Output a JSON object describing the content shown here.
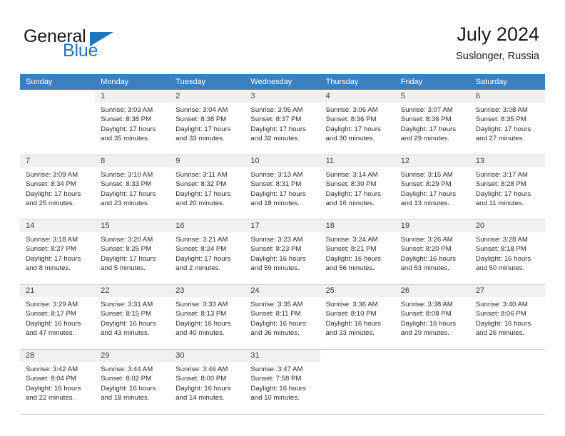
{
  "brand": {
    "name_top": "General",
    "name_bottom": "Blue",
    "color_blue": "#2175bb",
    "triangle_icon": "triangle-icon"
  },
  "header": {
    "title": "July 2024",
    "subtitle": "Suslonger, Russia"
  },
  "theme": {
    "header_row_bg": "#3b7fbf",
    "daynum_bg": "#f0f0f0",
    "grid_line": "#cfcfcf"
  },
  "weekdays": [
    "Sunday",
    "Monday",
    "Tuesday",
    "Wednesday",
    "Thursday",
    "Friday",
    "Saturday"
  ],
  "weeks": [
    [
      {
        "day": "",
        "lines": [
          "",
          "",
          "",
          ""
        ],
        "blank": true
      },
      {
        "day": "1",
        "lines": [
          "Sunrise: 3:03 AM",
          "Sunset: 8:38 PM",
          "Daylight: 17 hours",
          "and 35 minutes."
        ]
      },
      {
        "day": "2",
        "lines": [
          "Sunrise: 3:04 AM",
          "Sunset: 8:38 PM",
          "Daylight: 17 hours",
          "and 33 minutes."
        ]
      },
      {
        "day": "3",
        "lines": [
          "Sunrise: 3:05 AM",
          "Sunset: 8:37 PM",
          "Daylight: 17 hours",
          "and 32 minutes."
        ]
      },
      {
        "day": "4",
        "lines": [
          "Sunrise: 3:06 AM",
          "Sunset: 8:36 PM",
          "Daylight: 17 hours",
          "and 30 minutes."
        ]
      },
      {
        "day": "5",
        "lines": [
          "Sunrise: 3:07 AM",
          "Sunset: 8:36 PM",
          "Daylight: 17 hours",
          "and 29 minutes."
        ]
      },
      {
        "day": "6",
        "lines": [
          "Sunrise: 3:08 AM",
          "Sunset: 8:35 PM",
          "Daylight: 17 hours",
          "and 27 minutes."
        ]
      }
    ],
    [
      {
        "day": "7",
        "lines": [
          "Sunrise: 3:09 AM",
          "Sunset: 8:34 PM",
          "Daylight: 17 hours",
          "and 25 minutes."
        ]
      },
      {
        "day": "8",
        "lines": [
          "Sunrise: 3:10 AM",
          "Sunset: 8:33 PM",
          "Daylight: 17 hours",
          "and 23 minutes."
        ]
      },
      {
        "day": "9",
        "lines": [
          "Sunrise: 3:11 AM",
          "Sunset: 8:32 PM",
          "Daylight: 17 hours",
          "and 20 minutes."
        ]
      },
      {
        "day": "10",
        "lines": [
          "Sunrise: 3:13 AM",
          "Sunset: 8:31 PM",
          "Daylight: 17 hours",
          "and 18 minutes."
        ]
      },
      {
        "day": "11",
        "lines": [
          "Sunrise: 3:14 AM",
          "Sunset: 8:30 PM",
          "Daylight: 17 hours",
          "and 16 minutes."
        ]
      },
      {
        "day": "12",
        "lines": [
          "Sunrise: 3:15 AM",
          "Sunset: 8:29 PM",
          "Daylight: 17 hours",
          "and 13 minutes."
        ]
      },
      {
        "day": "13",
        "lines": [
          "Sunrise: 3:17 AM",
          "Sunset: 8:28 PM",
          "Daylight: 17 hours",
          "and 11 minutes."
        ]
      }
    ],
    [
      {
        "day": "14",
        "lines": [
          "Sunrise: 3:18 AM",
          "Sunset: 8:27 PM",
          "Daylight: 17 hours",
          "and 8 minutes."
        ]
      },
      {
        "day": "15",
        "lines": [
          "Sunrise: 3:20 AM",
          "Sunset: 8:25 PM",
          "Daylight: 17 hours",
          "and 5 minutes."
        ]
      },
      {
        "day": "16",
        "lines": [
          "Sunrise: 3:21 AM",
          "Sunset: 8:24 PM",
          "Daylight: 17 hours",
          "and 2 minutes."
        ]
      },
      {
        "day": "17",
        "lines": [
          "Sunrise: 3:23 AM",
          "Sunset: 8:23 PM",
          "Daylight: 16 hours",
          "and 59 minutes."
        ]
      },
      {
        "day": "18",
        "lines": [
          "Sunrise: 3:24 AM",
          "Sunset: 8:21 PM",
          "Daylight: 16 hours",
          "and 56 minutes."
        ]
      },
      {
        "day": "19",
        "lines": [
          "Sunrise: 3:26 AM",
          "Sunset: 8:20 PM",
          "Daylight: 16 hours",
          "and 53 minutes."
        ]
      },
      {
        "day": "20",
        "lines": [
          "Sunrise: 3:28 AM",
          "Sunset: 8:18 PM",
          "Daylight: 16 hours",
          "and 50 minutes."
        ]
      }
    ],
    [
      {
        "day": "21",
        "lines": [
          "Sunrise: 3:29 AM",
          "Sunset: 8:17 PM",
          "Daylight: 16 hours",
          "and 47 minutes."
        ]
      },
      {
        "day": "22",
        "lines": [
          "Sunrise: 3:31 AM",
          "Sunset: 8:15 PM",
          "Daylight: 16 hours",
          "and 43 minutes."
        ]
      },
      {
        "day": "23",
        "lines": [
          "Sunrise: 3:33 AM",
          "Sunset: 8:13 PM",
          "Daylight: 16 hours",
          "and 40 minutes."
        ]
      },
      {
        "day": "24",
        "lines": [
          "Sunrise: 3:35 AM",
          "Sunset: 8:11 PM",
          "Daylight: 16 hours",
          "and 36 minutes."
        ]
      },
      {
        "day": "25",
        "lines": [
          "Sunrise: 3:36 AM",
          "Sunset: 8:10 PM",
          "Daylight: 16 hours",
          "and 33 minutes."
        ]
      },
      {
        "day": "26",
        "lines": [
          "Sunrise: 3:38 AM",
          "Sunset: 8:08 PM",
          "Daylight: 16 hours",
          "and 29 minutes."
        ]
      },
      {
        "day": "27",
        "lines": [
          "Sunrise: 3:40 AM",
          "Sunset: 8:06 PM",
          "Daylight: 16 hours",
          "and 26 minutes."
        ]
      }
    ],
    [
      {
        "day": "28",
        "lines": [
          "Sunrise: 3:42 AM",
          "Sunset: 8:04 PM",
          "Daylight: 16 hours",
          "and 22 minutes."
        ]
      },
      {
        "day": "29",
        "lines": [
          "Sunrise: 3:44 AM",
          "Sunset: 8:02 PM",
          "Daylight: 16 hours",
          "and 18 minutes."
        ]
      },
      {
        "day": "30",
        "lines": [
          "Sunrise: 3:46 AM",
          "Sunset: 8:00 PM",
          "Daylight: 16 hours",
          "and 14 minutes."
        ]
      },
      {
        "day": "31",
        "lines": [
          "Sunrise: 3:47 AM",
          "Sunset: 7:58 PM",
          "Daylight: 16 hours",
          "and 10 minutes."
        ]
      },
      {
        "day": "",
        "lines": [
          "",
          "",
          "",
          ""
        ],
        "blank": true
      },
      {
        "day": "",
        "lines": [
          "",
          "",
          "",
          ""
        ],
        "blank": true
      },
      {
        "day": "",
        "lines": [
          "",
          "",
          "",
          ""
        ],
        "blank": true
      }
    ]
  ]
}
